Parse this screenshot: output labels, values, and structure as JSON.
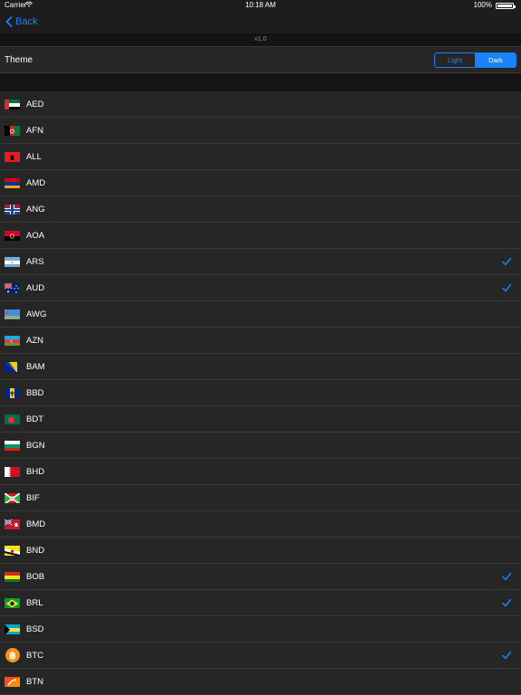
{
  "status_bar": {
    "carrier": "Carrier",
    "time": "10:18 AM",
    "battery": "100%"
  },
  "nav": {
    "back_label": "Back"
  },
  "version": "v1.0",
  "theme": {
    "label": "Theme",
    "options": [
      "Light",
      "Dark"
    ],
    "selected": "Dark"
  },
  "colors": {
    "accent": "#1a82fb",
    "background": "#262626",
    "separator": "#3a3a3a"
  },
  "currencies": [
    {
      "code": "AED",
      "checked": false
    },
    {
      "code": "AFN",
      "checked": false
    },
    {
      "code": "ALL",
      "checked": false
    },
    {
      "code": "AMD",
      "checked": false
    },
    {
      "code": "ANG",
      "checked": false
    },
    {
      "code": "AOA",
      "checked": false
    },
    {
      "code": "ARS",
      "checked": true
    },
    {
      "code": "AUD",
      "checked": true
    },
    {
      "code": "AWG",
      "checked": false
    },
    {
      "code": "AZN",
      "checked": false
    },
    {
      "code": "BAM",
      "checked": false
    },
    {
      "code": "BBD",
      "checked": false
    },
    {
      "code": "BDT",
      "checked": false
    },
    {
      "code": "BGN",
      "checked": false
    },
    {
      "code": "BHD",
      "checked": false
    },
    {
      "code": "BIF",
      "checked": false
    },
    {
      "code": "BMD",
      "checked": false
    },
    {
      "code": "BND",
      "checked": false
    },
    {
      "code": "BOB",
      "checked": true
    },
    {
      "code": "BRL",
      "checked": true
    },
    {
      "code": "BSD",
      "checked": false
    },
    {
      "code": "BTC",
      "checked": true
    },
    {
      "code": "BTN",
      "checked": false
    }
  ]
}
